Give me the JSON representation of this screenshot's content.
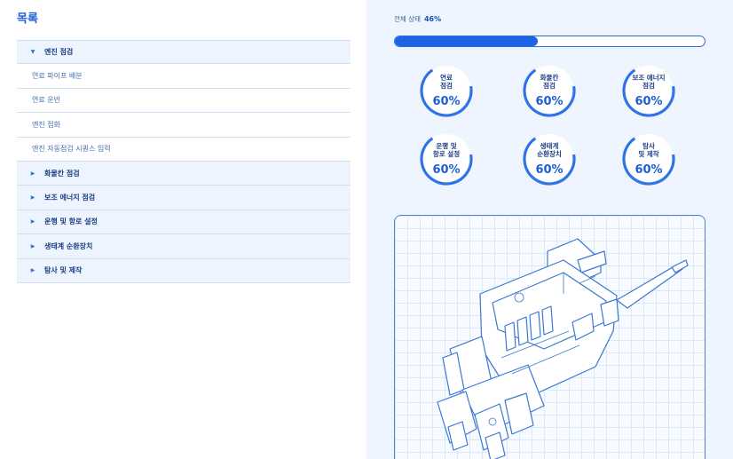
{
  "sidebar": {
    "title": "목록",
    "groups": [
      {
        "label": "엔진 점검",
        "expanded": true,
        "items": [
          "연료 파이프 배분",
          "연료 운반",
          "엔진 점화",
          "엔진 자동점검 시퀀스 입력"
        ]
      },
      {
        "label": "화물칸 점검",
        "expanded": false
      },
      {
        "label": "보조 에너지 점검",
        "expanded": false
      },
      {
        "label": "운행 및 항로 설정",
        "expanded": false
      },
      {
        "label": "생태계 순환장치",
        "expanded": false
      },
      {
        "label": "탐사 및 제작",
        "expanded": false
      }
    ]
  },
  "status": {
    "label": "전체 상태",
    "value": "46%",
    "progress": 0.46
  },
  "gauges": [
    {
      "label": "연료\n점검",
      "value": "60%"
    },
    {
      "label": "화물칸\n점검",
      "value": "60%"
    },
    {
      "label": "보조 에너지\n점검",
      "value": "60%"
    },
    {
      "label": "운행 및\n항로 설정",
      "value": "60%"
    },
    {
      "label": "생태계\n순환장치",
      "value": "60%"
    },
    {
      "label": "탐사\n및 제작",
      "value": "60%"
    }
  ],
  "colors": {
    "accent": "#1d5fd6",
    "panel_bg": "#eef5fe",
    "border": "#cfe0f5"
  },
  "icons": {
    "expanded": "caret-down-icon",
    "collapsed": "caret-right-icon"
  }
}
